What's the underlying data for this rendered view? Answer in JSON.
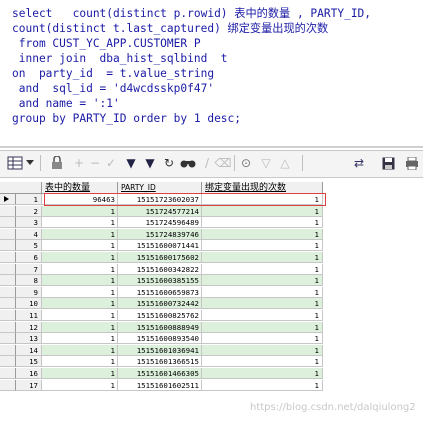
{
  "sql": {
    "lines": [
      "select   count(distinct p.rowid) 表中的数量 , PARTY_ID,",
      "count(distinct t.last_captured) 绑定变量出现的次数",
      " from CUST_YC_APP.CUSTOMER P",
      " inner join  dba_hist_sqlbind  t",
      "on  party_id  = t.value_string",
      " and  sql_id = 'd4wcdsskp0f47'",
      " and name = ':1'",
      "group by PARTY_ID order by 1 desc;"
    ]
  },
  "toolbar": {
    "icons": [
      "grid-icon",
      "dropdown-icon",
      "lock-icon",
      "add-icon",
      "delete-icon",
      "post-icon",
      "filter-icon",
      "filter-clear-icon",
      "refresh-icon",
      "find-icon",
      "pin-icon",
      "clear-icon",
      "query-icon",
      "triangle-icon",
      "export-icon",
      "save-icon",
      "print-icon"
    ]
  },
  "grid": {
    "columns": [
      "表中的数量",
      "PARTY_ID",
      "绑定变量出现的次数"
    ],
    "rows": [
      {
        "n": "1",
        "c1": "96463",
        "c2": "15151723602037",
        "c3": "1"
      },
      {
        "n": "2",
        "c1": "1",
        "c2": "151724577214",
        "c3": "1"
      },
      {
        "n": "3",
        "c1": "1",
        "c2": "151724596489",
        "c3": "1"
      },
      {
        "n": "4",
        "c1": "1",
        "c2": "151724839746",
        "c3": "1"
      },
      {
        "n": "5",
        "c1": "1",
        "c2": "15151600071441",
        "c3": "1"
      },
      {
        "n": "6",
        "c1": "1",
        "c2": "15151600175602",
        "c3": "1"
      },
      {
        "n": "7",
        "c1": "1",
        "c2": "15151600342822",
        "c3": "1"
      },
      {
        "n": "8",
        "c1": "1",
        "c2": "15151600385155",
        "c3": "1"
      },
      {
        "n": "9",
        "c1": "1",
        "c2": "15151600659873",
        "c3": "1"
      },
      {
        "n": "10",
        "c1": "1",
        "c2": "15151600732442",
        "c3": "1"
      },
      {
        "n": "11",
        "c1": "1",
        "c2": "15151600825762",
        "c3": "1"
      },
      {
        "n": "12",
        "c1": "1",
        "c2": "15151600888949",
        "c3": "1"
      },
      {
        "n": "13",
        "c1": "1",
        "c2": "15151600893540",
        "c3": "1"
      },
      {
        "n": "14",
        "c1": "1",
        "c2": "15151601036941",
        "c3": "1"
      },
      {
        "n": "15",
        "c1": "1",
        "c2": "15151601366515",
        "c3": "1"
      },
      {
        "n": "16",
        "c1": "1",
        "c2": "15151601466305",
        "c3": "1"
      },
      {
        "n": "17",
        "c1": "1",
        "c2": "15151601602511",
        "c3": "1"
      }
    ]
  },
  "watermark": "https://blog.csdn.net/dalqiulong2",
  "colors": {
    "keyword": "#1a1aa6",
    "row_alt": "#dcf0dc",
    "highlight": "#e04040"
  }
}
